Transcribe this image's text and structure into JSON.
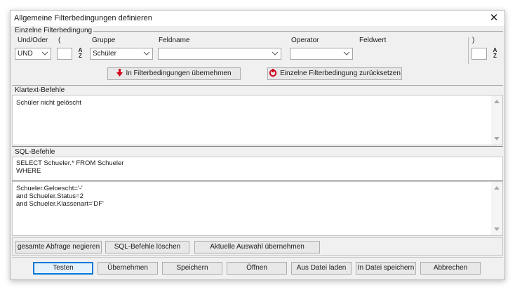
{
  "window": {
    "title": "Allgemeine Filterbedingungen definieren",
    "close_glyph": "✕"
  },
  "single_condition": {
    "section_label": "Einzelne Filterbedingung",
    "headers": {
      "and_or": "Und/Oder",
      "open_paren": "(",
      "group": "Gruppe",
      "field": "Feldname",
      "operator": "Operator",
      "value": "Feldwert",
      "close_paren": ")"
    },
    "and_or_value": "UND",
    "group_value": "Schüler",
    "field_value": "",
    "operator_value": "",
    "sort_glyph_top": "A",
    "sort_glyph_bottom": "Z",
    "apply_button": "In Filterbedingungen übernehmen",
    "reset_button": "Einzelne Filterbedingung zurücksetzen"
  },
  "plaintext": {
    "section_label": "Klartext-Befehle",
    "content": "Schüler nicht gelöscht"
  },
  "sql": {
    "section_label": "SQL-Befehle",
    "header_content": "SELECT Schueler.* FROM Schueler\nWHERE",
    "where_content": "Schueler.Geloescht='-'\nand Schueler.Status=2\nand Schueler.Klassenart='DF'"
  },
  "sql_buttons": {
    "negate": "gesamte Abfrage negieren",
    "delete": "SQL-Befehle löschen",
    "apply_selection": "Aktuelle Auswahl übernehmen"
  },
  "footer": {
    "test": "Testen",
    "accept": "Übernehmen",
    "save": "Speichern",
    "open": "Öffnen",
    "load_file": "Aus Datei laden",
    "save_file": "In Datei speichern",
    "cancel": "Abbrechen"
  },
  "colors": {
    "accent": "#0078d7",
    "arrow_red": "#d0021b"
  }
}
